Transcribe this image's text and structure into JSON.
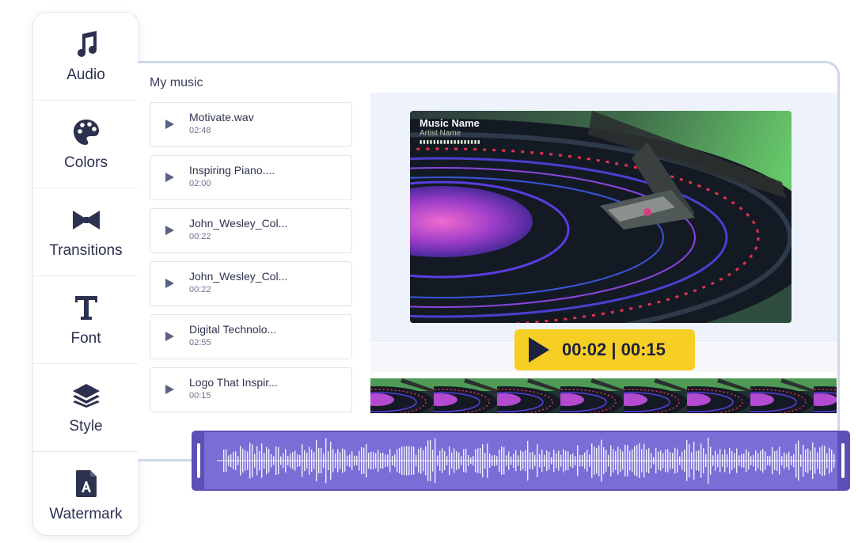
{
  "sidebar": {
    "items": [
      {
        "label": "Audio",
        "icon": "music-note-icon"
      },
      {
        "label": "Colors",
        "icon": "palette-icon"
      },
      {
        "label": "Transitions",
        "icon": "bowtie-icon"
      },
      {
        "label": "Font",
        "icon": "text-t-icon"
      },
      {
        "label": "Style",
        "icon": "layers-icon"
      },
      {
        "label": "Watermark",
        "icon": "document-a-icon"
      }
    ]
  },
  "panel": {
    "title": "My music",
    "tracks": [
      {
        "name": "Motivate.wav",
        "duration": "02:48"
      },
      {
        "name": "Inspiring Piano....",
        "duration": "02:00"
      },
      {
        "name": "John_Wesley_Col...",
        "duration": "00:22"
      },
      {
        "name": "John_Wesley_Col...",
        "duration": "00:22"
      },
      {
        "name": "Digital Technolo...",
        "duration": "02:55"
      },
      {
        "name": "Logo That Inspir...",
        "duration": "00:15"
      }
    ]
  },
  "video": {
    "title": "Music Name",
    "subtitle": "Artist Name"
  },
  "player": {
    "time": "00:02 | 00:15"
  },
  "colors": {
    "accent_yellow": "#f7cf24",
    "waveform_purple": "#7a6ed6",
    "sidebar_text": "#2c3150"
  }
}
